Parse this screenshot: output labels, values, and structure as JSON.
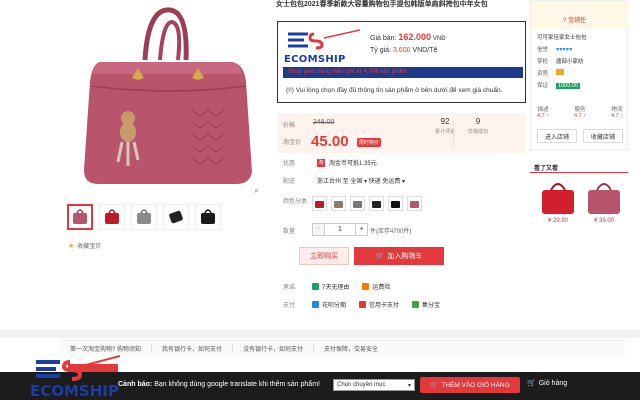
{
  "product": {
    "title": "女士包包2021春季新款大容量购物包手提包韩版单肩斜挎包中年女包",
    "favorite_label": "收藏宝贝",
    "thumbnails": [
      "pink",
      "red",
      "grey",
      "black-small",
      "black"
    ]
  },
  "ecomship": {
    "brand": "ECOMSHIP",
    "price_label": "Giá bán:",
    "price_value": "162.000",
    "price_unit": "VNĐ",
    "rate_label": "Tỷ giá:",
    "rate_value": "3.600",
    "rate_unit": "VND/Tệ",
    "promo_bar": "Shop giao hàng miễn phí từ 4.708 sản phẩm",
    "note": "(!!) Vui lòng chọn đầy đủ thông tin sản phẩm ở bên dưới để xem giá chuẩn."
  },
  "pricing": {
    "orig_label": "价格",
    "orig_price": "248.00",
    "cur_label": "淘宝价",
    "cur_price": "45.00",
    "badge": "限时特价",
    "stat1_num": "92",
    "stat1_label": "累计评论",
    "stat2_num": "9",
    "stat2_label": "交易成功"
  },
  "info": {
    "promo_label": "优惠",
    "promo_text": "淘金币可抵1.35元",
    "ship_label": "配送",
    "ship_text": "浙江台州 至  全国 ▾   快递 免运费 ▾",
    "color_label": "颜色分类",
    "qty_label": "数量",
    "qty_value": "1",
    "stock_text": "件(库存4700件)"
  },
  "buttons": {
    "buy_now": "立即购买",
    "add_cart": "加入购物车"
  },
  "services": {
    "promise_label": "承诺",
    "promise1": "7天无理由",
    "promise2": "运费险",
    "pay_label": "支付",
    "pay1": "花呗分期",
    "pay2": "信用卡支付",
    "pay3": "集分宝"
  },
  "shop": {
    "shop_btn": "? 宝铺任",
    "name_title": "可可家佳家女士包包",
    "row1_label": "信誉",
    "row1_value": "♥♥♥♥♥",
    "row2_label": "掌柜",
    "row2_value": "唐部小家纺",
    "row3_label": "资质",
    "row3_value": "",
    "row4_label": "保证",
    "row4_value": "1000.00",
    "score1_label": "描述",
    "score1_value": "4.7 ↑",
    "score2_label": "服务",
    "score2_value": "4.7 ↑",
    "score3_label": "物流",
    "score3_value": "4.7 ↑",
    "enter_shop": "进入店铺",
    "fav_shop": "收藏店铺",
    "also_title": "看了又看",
    "also1_price": "¥ 29.90",
    "also2_price": "¥ 39.00"
  },
  "pay_strip": {
    "item1": "第一次淘宝购物?  购物须知",
    "item2": "我有银行卡，如何支付",
    "item3": "没有银行卡，如何支付",
    "item4": "支付保障，交易安全"
  },
  "bottom_bar": {
    "warn_label": "Cảnh báo:",
    "warn_text": "Bạn không dùng google translate khi thêm sản phẩm!",
    "select_value": "Chọn chuyên mục",
    "add_btn": "THÊM VÀO GIỎ HÀNG",
    "cart_label": "Giỏ hàng"
  },
  "colors": {
    "accent": "#e4393c",
    "brand_blue": "#1a3da6",
    "bag_pink": "#b8546c",
    "bar_dark": "#1c1c1c"
  }
}
